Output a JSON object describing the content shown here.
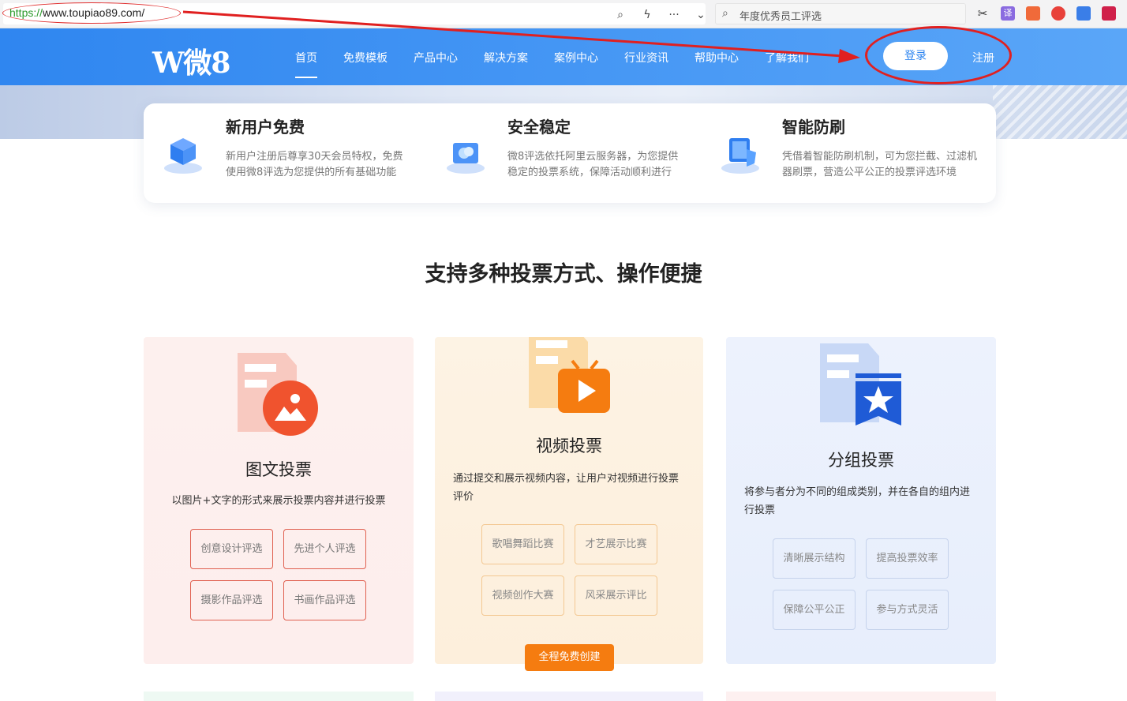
{
  "browser": {
    "url_scheme": "https://",
    "url_rest": "www.toupiao89.com/",
    "search_text": "年度优秀员工评选",
    "tool_icons": [
      "search-icon",
      "lightning-icon",
      "more-icon",
      "chevron-down-icon"
    ],
    "ext_icons": [
      "scissors-icon",
      "translate-icon",
      "game-icon",
      "weibo-icon",
      "mail-icon",
      "extension-icon"
    ],
    "translate_glyph": "译"
  },
  "header": {
    "logo": "W微8",
    "nav": [
      "首页",
      "免费模板",
      "产品中心",
      "解决方案",
      "案例中心",
      "行业资讯",
      "帮助中心",
      "了解我们"
    ],
    "login": "登录",
    "register": "注册",
    "accent": "#2f86f0"
  },
  "features": [
    {
      "title": "新用户免费",
      "desc": "新用户注册后尊享30天会员特权，免费使用微8评选为您提供的所有基础功能",
      "icon": "cubes-icon"
    },
    {
      "title": "安全稳定",
      "desc": "微8评选依托阿里云服务器，为您提供稳定的投票系统，保障活动顺利进行",
      "icon": "cloud-icon"
    },
    {
      "title": "智能防刷",
      "desc": "凭借着智能防刷机制，可为您拦截、过滤机器刷票，营造公平公正的投票评选环境",
      "icon": "shield-screen-icon"
    }
  ],
  "section_title": "支持多种投票方式、操作便捷",
  "cards": [
    {
      "title": "图文投票",
      "desc": "以图片+文字的形式来展示投票内容并进行投票",
      "tags": [
        "创意设计评选",
        "先进个人评选",
        "摄影作品评选",
        "书画作品评选"
      ],
      "icon": "image-document-icon",
      "accent": "#f0532e"
    },
    {
      "title": "视频投票",
      "desc": "通过提交和展示视频内容，让用户对视频进行投票评价",
      "tags": [
        "歌唱舞蹈比赛",
        "才艺展示比赛",
        "视频创作大赛",
        "风采展示评比"
      ],
      "icon": "video-document-icon",
      "accent": "#f57c10",
      "cta": "全程免费创建"
    },
    {
      "title": "分组投票",
      "desc": "将参与者分为不同的组成类别，并在各自的组内进行投票",
      "tags": [
        "清晰展示结构",
        "提高投票效率",
        "保障公平公正",
        "参与方式灵活"
      ],
      "icon": "star-badge-document-icon",
      "accent": "#1f5bd6"
    }
  ]
}
